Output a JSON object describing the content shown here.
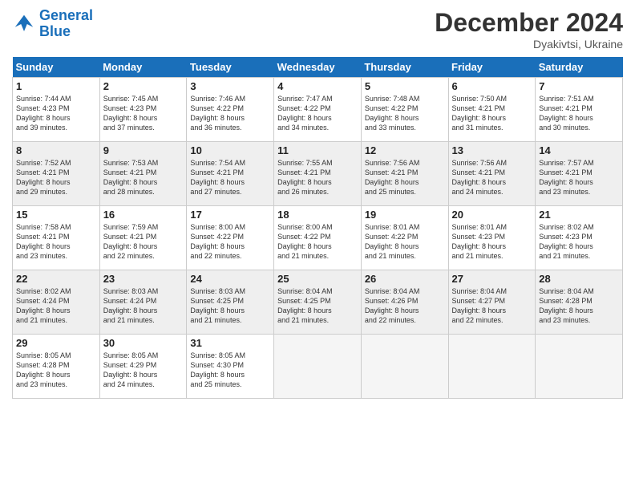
{
  "header": {
    "logo_line1": "General",
    "logo_line2": "Blue",
    "month": "December 2024",
    "location": "Dyakivtsi, Ukraine"
  },
  "weekdays": [
    "Sunday",
    "Monday",
    "Tuesday",
    "Wednesday",
    "Thursday",
    "Friday",
    "Saturday"
  ],
  "weeks": [
    [
      {
        "day": "1",
        "info": "Sunrise: 7:44 AM\nSunset: 4:23 PM\nDaylight: 8 hours\nand 39 minutes."
      },
      {
        "day": "2",
        "info": "Sunrise: 7:45 AM\nSunset: 4:23 PM\nDaylight: 8 hours\nand 37 minutes."
      },
      {
        "day": "3",
        "info": "Sunrise: 7:46 AM\nSunset: 4:22 PM\nDaylight: 8 hours\nand 36 minutes."
      },
      {
        "day": "4",
        "info": "Sunrise: 7:47 AM\nSunset: 4:22 PM\nDaylight: 8 hours\nand 34 minutes."
      },
      {
        "day": "5",
        "info": "Sunrise: 7:48 AM\nSunset: 4:22 PM\nDaylight: 8 hours\nand 33 minutes."
      },
      {
        "day": "6",
        "info": "Sunrise: 7:50 AM\nSunset: 4:21 PM\nDaylight: 8 hours\nand 31 minutes."
      },
      {
        "day": "7",
        "info": "Sunrise: 7:51 AM\nSunset: 4:21 PM\nDaylight: 8 hours\nand 30 minutes."
      }
    ],
    [
      {
        "day": "8",
        "info": "Sunrise: 7:52 AM\nSunset: 4:21 PM\nDaylight: 8 hours\nand 29 minutes."
      },
      {
        "day": "9",
        "info": "Sunrise: 7:53 AM\nSunset: 4:21 PM\nDaylight: 8 hours\nand 28 minutes."
      },
      {
        "day": "10",
        "info": "Sunrise: 7:54 AM\nSunset: 4:21 PM\nDaylight: 8 hours\nand 27 minutes."
      },
      {
        "day": "11",
        "info": "Sunrise: 7:55 AM\nSunset: 4:21 PM\nDaylight: 8 hours\nand 26 minutes."
      },
      {
        "day": "12",
        "info": "Sunrise: 7:56 AM\nSunset: 4:21 PM\nDaylight: 8 hours\nand 25 minutes."
      },
      {
        "day": "13",
        "info": "Sunrise: 7:56 AM\nSunset: 4:21 PM\nDaylight: 8 hours\nand 24 minutes."
      },
      {
        "day": "14",
        "info": "Sunrise: 7:57 AM\nSunset: 4:21 PM\nDaylight: 8 hours\nand 23 minutes."
      }
    ],
    [
      {
        "day": "15",
        "info": "Sunrise: 7:58 AM\nSunset: 4:21 PM\nDaylight: 8 hours\nand 23 minutes."
      },
      {
        "day": "16",
        "info": "Sunrise: 7:59 AM\nSunset: 4:21 PM\nDaylight: 8 hours\nand 22 minutes."
      },
      {
        "day": "17",
        "info": "Sunrise: 8:00 AM\nSunset: 4:22 PM\nDaylight: 8 hours\nand 22 minutes."
      },
      {
        "day": "18",
        "info": "Sunrise: 8:00 AM\nSunset: 4:22 PM\nDaylight: 8 hours\nand 21 minutes."
      },
      {
        "day": "19",
        "info": "Sunrise: 8:01 AM\nSunset: 4:22 PM\nDaylight: 8 hours\nand 21 minutes."
      },
      {
        "day": "20",
        "info": "Sunrise: 8:01 AM\nSunset: 4:23 PM\nDaylight: 8 hours\nand 21 minutes."
      },
      {
        "day": "21",
        "info": "Sunrise: 8:02 AM\nSunset: 4:23 PM\nDaylight: 8 hours\nand 21 minutes."
      }
    ],
    [
      {
        "day": "22",
        "info": "Sunrise: 8:02 AM\nSunset: 4:24 PM\nDaylight: 8 hours\nand 21 minutes."
      },
      {
        "day": "23",
        "info": "Sunrise: 8:03 AM\nSunset: 4:24 PM\nDaylight: 8 hours\nand 21 minutes."
      },
      {
        "day": "24",
        "info": "Sunrise: 8:03 AM\nSunset: 4:25 PM\nDaylight: 8 hours\nand 21 minutes."
      },
      {
        "day": "25",
        "info": "Sunrise: 8:04 AM\nSunset: 4:25 PM\nDaylight: 8 hours\nand 21 minutes."
      },
      {
        "day": "26",
        "info": "Sunrise: 8:04 AM\nSunset: 4:26 PM\nDaylight: 8 hours\nand 22 minutes."
      },
      {
        "day": "27",
        "info": "Sunrise: 8:04 AM\nSunset: 4:27 PM\nDaylight: 8 hours\nand 22 minutes."
      },
      {
        "day": "28",
        "info": "Sunrise: 8:04 AM\nSunset: 4:28 PM\nDaylight: 8 hours\nand 23 minutes."
      }
    ],
    [
      {
        "day": "29",
        "info": "Sunrise: 8:05 AM\nSunset: 4:28 PM\nDaylight: 8 hours\nand 23 minutes."
      },
      {
        "day": "30",
        "info": "Sunrise: 8:05 AM\nSunset: 4:29 PM\nDaylight: 8 hours\nand 24 minutes."
      },
      {
        "day": "31",
        "info": "Sunrise: 8:05 AM\nSunset: 4:30 PM\nDaylight: 8 hours\nand 25 minutes."
      },
      {
        "day": "",
        "info": ""
      },
      {
        "day": "",
        "info": ""
      },
      {
        "day": "",
        "info": ""
      },
      {
        "day": "",
        "info": ""
      }
    ]
  ]
}
